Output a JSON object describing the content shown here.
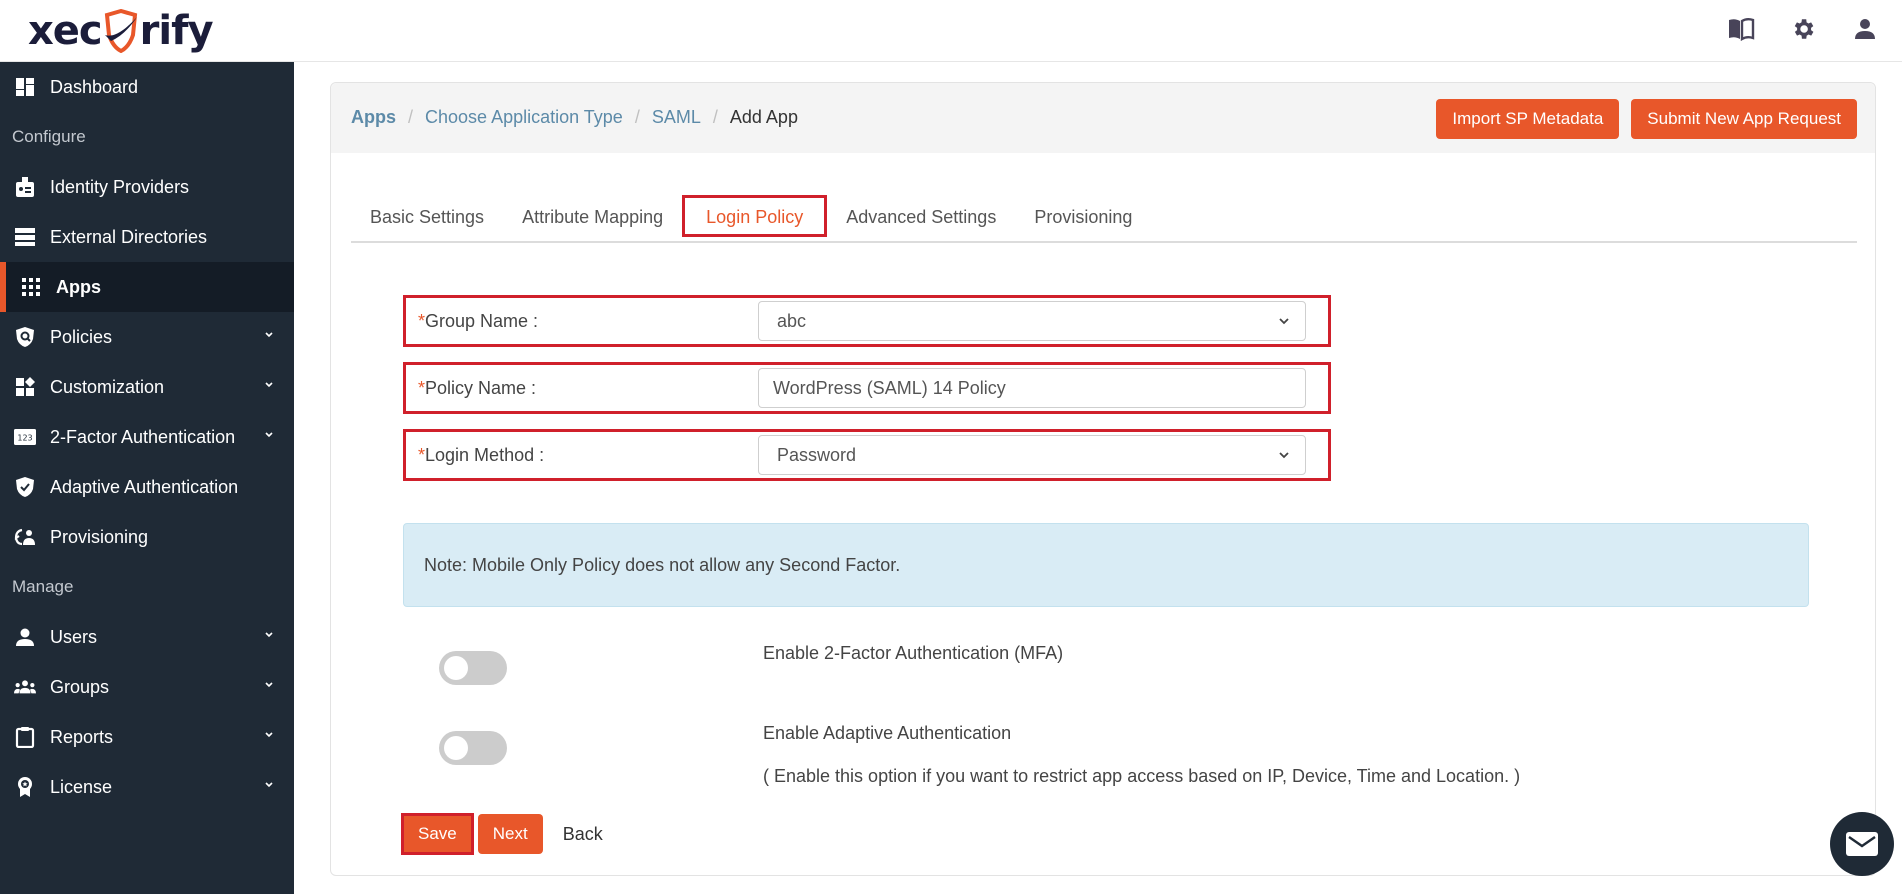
{
  "brand": {
    "logo_left": "xec",
    "logo_right": "rify",
    "accent": "#e8572a",
    "sidebar_bg": "#1f2a36"
  },
  "topbar": {
    "icons": [
      "book-icon",
      "gear-icon",
      "user-icon"
    ]
  },
  "sidebar": {
    "items": [
      {
        "type": "item",
        "label": "Dashboard",
        "icon": "dashboard-icon",
        "expandable": false
      },
      {
        "type": "section",
        "label": "Configure"
      },
      {
        "type": "item",
        "label": "Identity Providers",
        "icon": "id-badge-icon",
        "expandable": false
      },
      {
        "type": "item",
        "label": "External Directories",
        "icon": "directories-icon",
        "expandable": false
      },
      {
        "type": "item",
        "label": "Apps",
        "icon": "apps-grid-icon",
        "expandable": false,
        "active": true
      },
      {
        "type": "item",
        "label": "Policies",
        "icon": "shield-search-icon",
        "expandable": true
      },
      {
        "type": "item",
        "label": "Customization",
        "icon": "customization-icon",
        "expandable": true
      },
      {
        "type": "item",
        "label": "2-Factor Authentication",
        "icon": "numeric-123-icon",
        "expandable": true
      },
      {
        "type": "item",
        "label": "Adaptive Authentication",
        "icon": "shield-check-icon",
        "expandable": false
      },
      {
        "type": "item",
        "label": "Provisioning",
        "icon": "provisioning-icon",
        "expandable": false
      },
      {
        "type": "section",
        "label": "Manage"
      },
      {
        "type": "item",
        "label": "Users",
        "icon": "user-icon",
        "expandable": true
      },
      {
        "type": "item",
        "label": "Groups",
        "icon": "groups-icon",
        "expandable": true
      },
      {
        "type": "item",
        "label": "Reports",
        "icon": "clipboard-icon",
        "expandable": true
      },
      {
        "type": "item",
        "label": "License",
        "icon": "award-icon",
        "expandable": true
      }
    ]
  },
  "breadcrumb": {
    "items": [
      "Apps",
      "Choose Application Type",
      "SAML",
      "Add App"
    ],
    "separator": "/"
  },
  "header_buttons": {
    "import": "Import SP Metadata",
    "submit": "Submit New App Request"
  },
  "tabs": [
    {
      "label": "Basic Settings",
      "active": false
    },
    {
      "label": "Attribute Mapping",
      "active": false
    },
    {
      "label": "Login Policy",
      "active": true
    },
    {
      "label": "Advanced Settings",
      "active": false
    },
    {
      "label": "Provisioning",
      "active": false
    }
  ],
  "form": {
    "required_mark": "*",
    "group_name": {
      "label": "Group Name :",
      "value": "abc"
    },
    "policy_name": {
      "label": "Policy Name :",
      "value": "WordPress (SAML) 14 Policy"
    },
    "login_method": {
      "label": "Login Method :",
      "value": "Password"
    }
  },
  "note": "Note: Mobile Only Policy does not allow any Second Factor.",
  "toggles": {
    "mfa": {
      "label": "Enable 2-Factor Authentication (MFA)",
      "enabled": false
    },
    "adaptive": {
      "label": "Enable Adaptive Authentication",
      "enabled": false,
      "hint": "( Enable this option if you want to restrict app access based on IP, Device, Time and Location. )"
    }
  },
  "actions": {
    "save": "Save",
    "next": "Next",
    "back": "Back"
  }
}
